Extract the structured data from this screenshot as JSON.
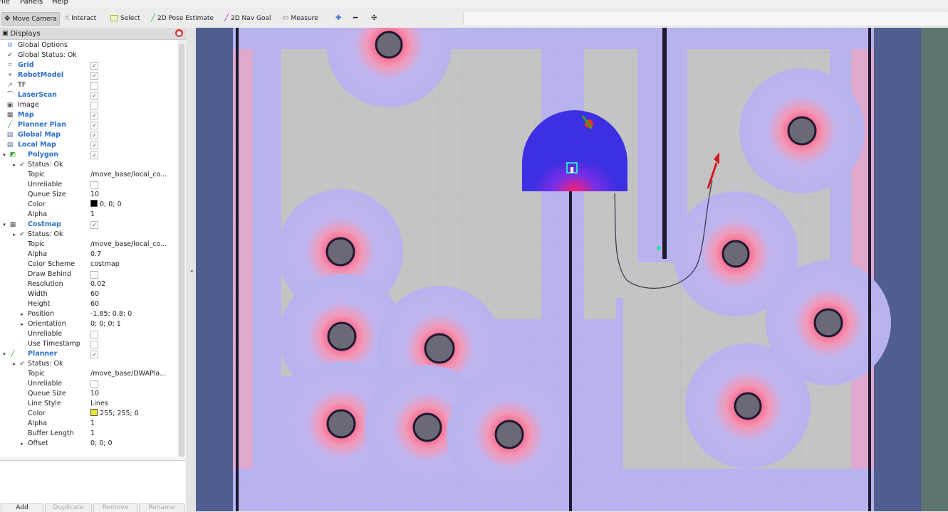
{
  "menu": [
    "File",
    "Panels",
    "Help"
  ],
  "toolbar": {
    "tools": [
      {
        "label": "Move Camera",
        "icon": "move-camera-icon",
        "active": true
      },
      {
        "label": "Interact",
        "icon": "interact-icon"
      },
      {
        "label": "Select",
        "icon": "select-icon"
      },
      {
        "label": "2D Pose Estimate",
        "icon": "pose-estimate-icon"
      },
      {
        "label": "2D Nav Goal",
        "icon": "nav-goal-icon"
      },
      {
        "label": "Measure",
        "icon": "measure-icon"
      }
    ]
  },
  "displays_panel": {
    "title": "Displays",
    "rows": [
      {
        "name": "Global Options"
      },
      {
        "name": "Global Status: Ok"
      },
      {
        "name": "Grid",
        "checked": true
      },
      {
        "name": "RobotModel",
        "checked": true
      },
      {
        "name": "TF",
        "checked": false
      },
      {
        "name": "LaserScan",
        "checked": true
      },
      {
        "name": "Image",
        "checked": false
      },
      {
        "name": "Map",
        "checked": true
      },
      {
        "name": "Planner Plan",
        "checked": true
      },
      {
        "name": "Global Map",
        "checked": true
      },
      {
        "name": "Local Map",
        "checked": true
      },
      {
        "name": "Polygon",
        "checked": true
      },
      {
        "name": "Status: Ok"
      },
      {
        "name": "Topic",
        "value": "/move_base/local_co..."
      },
      {
        "name": "Unreliable",
        "checked": false
      },
      {
        "name": "Queue Size",
        "value": "10"
      },
      {
        "name": "Color",
        "value": "0; 0; 0",
        "swatch": "#000000"
      },
      {
        "name": "Alpha",
        "value": "1"
      },
      {
        "name": "Costmap",
        "checked": true
      },
      {
        "name": "Status: Ok"
      },
      {
        "name": "Topic",
        "value": "/move_base/local_co..."
      },
      {
        "name": "Alpha",
        "value": "0.7"
      },
      {
        "name": "Color Scheme",
        "value": "costmap"
      },
      {
        "name": "Draw Behind",
        "checked": false
      },
      {
        "name": "Resolution",
        "value": "0.02"
      },
      {
        "name": "Width",
        "value": "60"
      },
      {
        "name": "Height",
        "value": "60"
      },
      {
        "name": "Position",
        "value": "-1.85; 0.8; 0"
      },
      {
        "name": "Orientation",
        "value": "0; 0; 0; 1"
      },
      {
        "name": "Unreliable",
        "checked": false
      },
      {
        "name": "Use Timestamp",
        "checked": false
      },
      {
        "name": "Planner",
        "checked": true
      },
      {
        "name": "Status: Ok"
      },
      {
        "name": "Topic",
        "value": "/move_base/DWAPla..."
      },
      {
        "name": "Unreliable",
        "checked": false
      },
      {
        "name": "Queue Size",
        "value": "10"
      },
      {
        "name": "Line Style",
        "value": "Lines"
      },
      {
        "name": "Color",
        "value": "255; 255; 0",
        "swatch": "#e6ea2a"
      },
      {
        "name": "Alpha",
        "value": "1"
      },
      {
        "name": "Buffer Length",
        "value": "1"
      },
      {
        "name": "Offset",
        "value": "0; 0; 0"
      }
    ],
    "buttons": [
      {
        "label": "Add",
        "enabled": true
      },
      {
        "label": "Duplicate",
        "enabled": false
      },
      {
        "label": "Remove",
        "enabled": false
      },
      {
        "label": "Rename",
        "enabled": false
      }
    ]
  },
  "colors": {
    "costmap_inflation": "#b7b3ee",
    "free_space": "#c4c4c4",
    "obstacle": "#2a1f3d",
    "local_costmap": "#3d2fe2",
    "goal_arrow": "#d11a1a",
    "path": "#3c3c50"
  }
}
